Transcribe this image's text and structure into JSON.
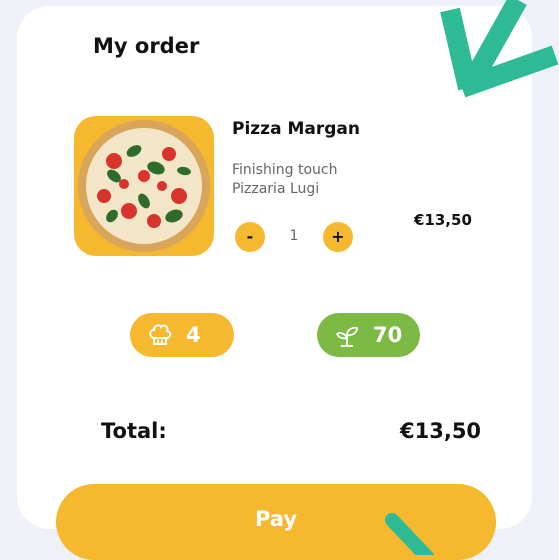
{
  "order": {
    "title": "My order",
    "item": {
      "name": "Pizza Margan",
      "description_line1": "Finishing touch",
      "description_line2": "Pizzaria Lugi",
      "quantity": "1",
      "minus_label": "-",
      "plus_label": "+",
      "price": "€13,50",
      "image_icon": "pizza-photo"
    },
    "stats": {
      "chef_icon": "chef-hat-icon",
      "chef_value": "4",
      "eco_icon": "sprout-icon",
      "eco_value": "70"
    },
    "total_label": "Total:",
    "total_value": "€13,50",
    "pay_label": "Pay"
  },
  "colors": {
    "accent_yellow": "#f5b82e",
    "accent_green": "#7dba45",
    "arrow_teal": "#2dba94",
    "background": "#eef1f7"
  }
}
